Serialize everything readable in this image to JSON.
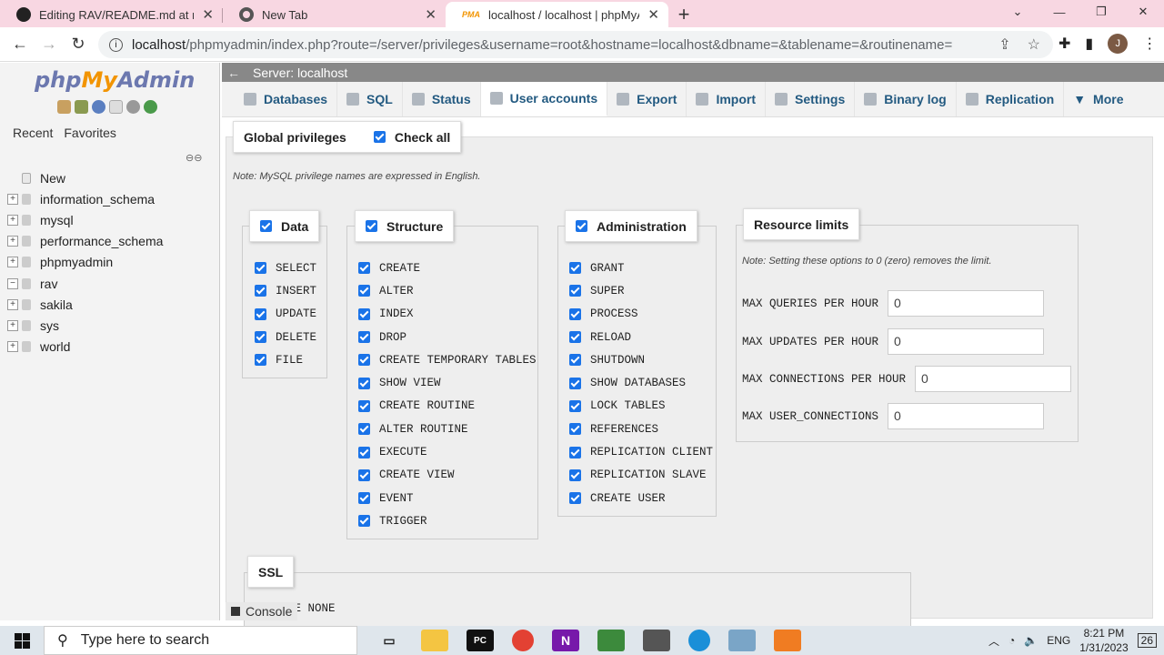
{
  "browser": {
    "tabs": [
      {
        "title": "Editing RAV/README.md at mast",
        "icon": "github-icon"
      },
      {
        "title": "New Tab",
        "icon": "chrome-icon"
      },
      {
        "title": "localhost / localhost | phpMyAdm",
        "icon": "pma-icon"
      }
    ],
    "url_host": "localhost",
    "url_rest": "/phpmyadmin/index.php?route=/server/privileges&username=root&hostname=localhost&dbname=&tablename=&routinename=",
    "avatar": "J"
  },
  "nav": {
    "logo": {
      "php": "php",
      "my": "My",
      "admin": "Admin"
    },
    "tabs": [
      "Recent",
      "Favorites"
    ],
    "new_label": "New",
    "databases": [
      "information_schema",
      "mysql",
      "performance_schema",
      "phpmyadmin",
      "rav",
      "sakila",
      "sys",
      "world"
    ]
  },
  "server": {
    "label": "Server: localhost"
  },
  "menu": [
    {
      "label": "Databases",
      "icon": "database-icon"
    },
    {
      "label": "SQL",
      "icon": "sql-icon"
    },
    {
      "label": "Status",
      "icon": "status-icon"
    },
    {
      "label": "User accounts",
      "icon": "users-icon",
      "active": true
    },
    {
      "label": "Export",
      "icon": "export-icon"
    },
    {
      "label": "Import",
      "icon": "import-icon"
    },
    {
      "label": "Settings",
      "icon": "wrench-icon"
    },
    {
      "label": "Binary log",
      "icon": "log-icon"
    },
    {
      "label": "Replication",
      "icon": "replication-icon"
    },
    {
      "label": "More",
      "icon": "caret-down-icon"
    }
  ],
  "privileges": {
    "legend": "Global privileges",
    "check_all": "Check all",
    "note": "Note: MySQL privilege names are expressed in English.",
    "data": {
      "title": "Data",
      "items": [
        "SELECT",
        "INSERT",
        "UPDATE",
        "DELETE",
        "FILE"
      ]
    },
    "structure": {
      "title": "Structure",
      "items": [
        "CREATE",
        "ALTER",
        "INDEX",
        "DROP",
        "CREATE TEMPORARY TABLES",
        "SHOW VIEW",
        "CREATE ROUTINE",
        "ALTER ROUTINE",
        "EXECUTE",
        "CREATE VIEW",
        "EVENT",
        "TRIGGER"
      ]
    },
    "admin": {
      "title": "Administration",
      "items": [
        "GRANT",
        "SUPER",
        "PROCESS",
        "RELOAD",
        "SHUTDOWN",
        "SHOW DATABASES",
        "LOCK TABLES",
        "REFERENCES",
        "REPLICATION CLIENT",
        "REPLICATION SLAVE",
        "CREATE USER"
      ]
    },
    "limits": {
      "title": "Resource limits",
      "note": "Note: Setting these options to 0 (zero) removes the limit.",
      "fields": [
        {
          "label": "MAX QUERIES PER HOUR",
          "value": "0"
        },
        {
          "label": "MAX UPDATES PER HOUR",
          "value": "0"
        },
        {
          "label": "MAX CONNECTIONS PER HOUR",
          "value": "0"
        },
        {
          "label": "MAX USER_CONNECTIONS",
          "value": "0"
        }
      ]
    },
    "ssl": {
      "title": "SSL",
      "option": "RE NONE"
    }
  },
  "console": "Console",
  "taskbar": {
    "search_placeholder": "Type here to search",
    "lang": "ENG",
    "time": "8:21 PM",
    "date": "1/31/2023",
    "notifications": "26"
  }
}
